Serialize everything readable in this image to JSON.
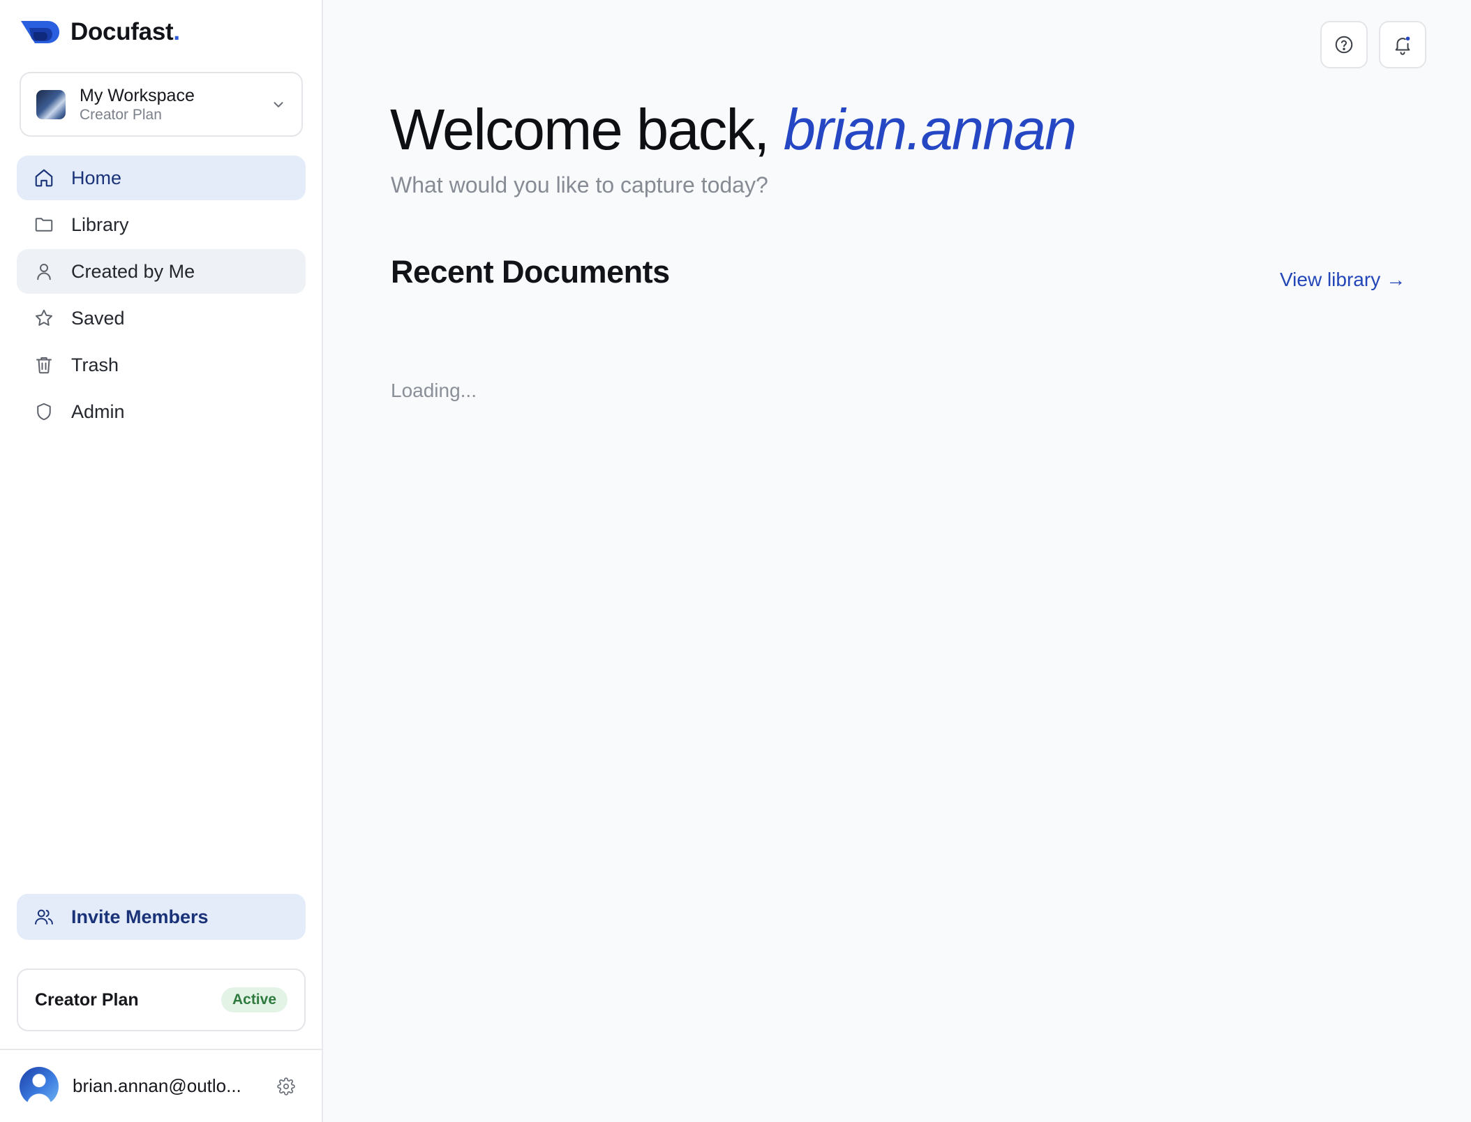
{
  "brand": {
    "name": "Docufast",
    "dot": "."
  },
  "workspace": {
    "name": "My Workspace",
    "plan": "Creator Plan"
  },
  "nav": [
    {
      "label": "Home",
      "icon": "home-icon",
      "state": "active"
    },
    {
      "label": "Library",
      "icon": "folder-icon",
      "state": ""
    },
    {
      "label": "Created by Me",
      "icon": "user-icon",
      "state": "hover"
    },
    {
      "label": "Saved",
      "icon": "star-icon",
      "state": ""
    },
    {
      "label": "Trash",
      "icon": "trash-icon",
      "state": ""
    },
    {
      "label": "Admin",
      "icon": "shield-icon",
      "state": ""
    }
  ],
  "invite": {
    "label": "Invite Members"
  },
  "plan_card": {
    "name": "Creator Plan",
    "status": "Active"
  },
  "user": {
    "email": "brian.annan@outlo..."
  },
  "main": {
    "welcome_prefix": "Welcome back, ",
    "welcome_name": "brian.annan",
    "subtitle": "What would you like to capture today?",
    "section_title": "Recent Documents",
    "view_library": "View library",
    "view_library_arrow": "→",
    "loading": "Loading..."
  },
  "colors": {
    "accent": "#2547c4",
    "active_nav_bg": "#e4ecfa",
    "badge_bg": "#e3f3e6",
    "badge_text": "#2f7a3f",
    "page_bg": "#f8fafc"
  }
}
